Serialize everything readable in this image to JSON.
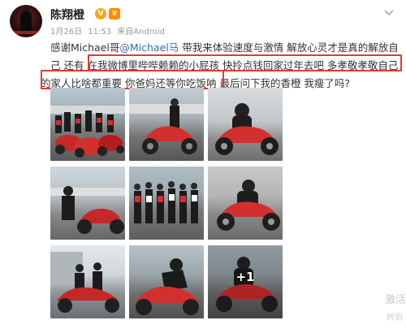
{
  "user": {
    "name": "陈翔橙",
    "badges": [
      "V",
      "♛"
    ]
  },
  "meta": {
    "date": "1月26日",
    "time": "11:53",
    "source_prefix": "来自",
    "source": "Android"
  },
  "post": {
    "line1_a": "感谢Michael哥",
    "mention": "@Michael马",
    "line1_b": " 带我来体验速度与激情  解放心灵才是真的解放自",
    "line2": "己  还有 在我微博里哔哔赖赖的小屁孩  快拎点钱回家过年去吧  多孝敬孝敬自己",
    "line3": "的家人比啥都重要  你爸妈还等你吃饭呐  最后问下我的香橙  我瘦了吗?"
  },
  "photos": [
    {
      "alt": "team group photo with red motorcycles"
    },
    {
      "alt": "rider with red Ducati on track"
    },
    {
      "alt": "rider on red motorcycle"
    },
    {
      "alt": "rider posing by red motorcycle"
    },
    {
      "alt": "team lineup on race track"
    },
    {
      "alt": "rider cornering on red motorcycle"
    },
    {
      "alt": "two riders with motorcycle by pit building"
    },
    {
      "alt": "rider leaning on track"
    },
    {
      "alt": "rider seated on motorcycle",
      "more_label": "+1"
    }
  ],
  "watermark": {
    "line1": "激活",
    "line2": "转到"
  },
  "colors": {
    "highlight": "#e23b2f",
    "mention": "#3b6aa8",
    "badge_v": "#f5a623"
  }
}
